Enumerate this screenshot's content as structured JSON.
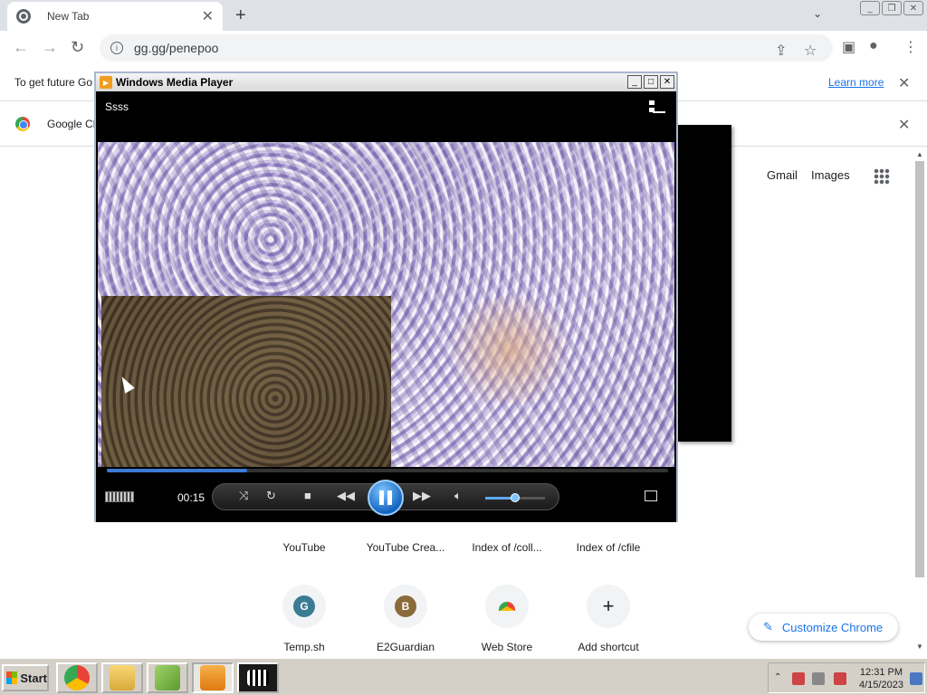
{
  "browser": {
    "tab_title": "New Tab",
    "tab_close": "✕",
    "new_tab": "+",
    "tab_search": "⌄",
    "url": "gg.gg/penepoo",
    "window_buttons": [
      "_",
      "❐",
      "✕"
    ]
  },
  "infobar": {
    "message": "To get future Go",
    "learn_more": "Learn more",
    "close": "✕"
  },
  "infobar2": {
    "message": "Google Ch",
    "close": "✕"
  },
  "ntp": {
    "gmail": "Gmail",
    "images": "Images",
    "shortcuts_row1": [
      "YouTube",
      "YouTube Crea...",
      "Index of /coll...",
      "Index of /cfile"
    ],
    "shortcuts_row2": [
      {
        "label": "Temp.sh",
        "letter": "G",
        "color": "#3b7c93"
      },
      {
        "label": "E2Guardian",
        "letter": "B",
        "color": "#8a6a3a"
      },
      {
        "label": "Web Store",
        "letter": "",
        "color": "#ffffff"
      },
      {
        "label": "Add shortcut",
        "letter": "+",
        "color": "#f1f3f4"
      }
    ],
    "customize": "Customize Chrome"
  },
  "wmp": {
    "title": "Windows Media Player",
    "now_playing": "Ssss",
    "time": "00:15",
    "progress": 0.25,
    "volume": 0.5,
    "title_buttons": [
      "_",
      "□",
      "✕"
    ]
  },
  "taskbar": {
    "start": "Start",
    "clock_time": "12:31 PM",
    "clock_date": "4/15/2023"
  },
  "colors": {
    "accent": "#1a73e8",
    "wmp_blue": "#1565c0"
  }
}
